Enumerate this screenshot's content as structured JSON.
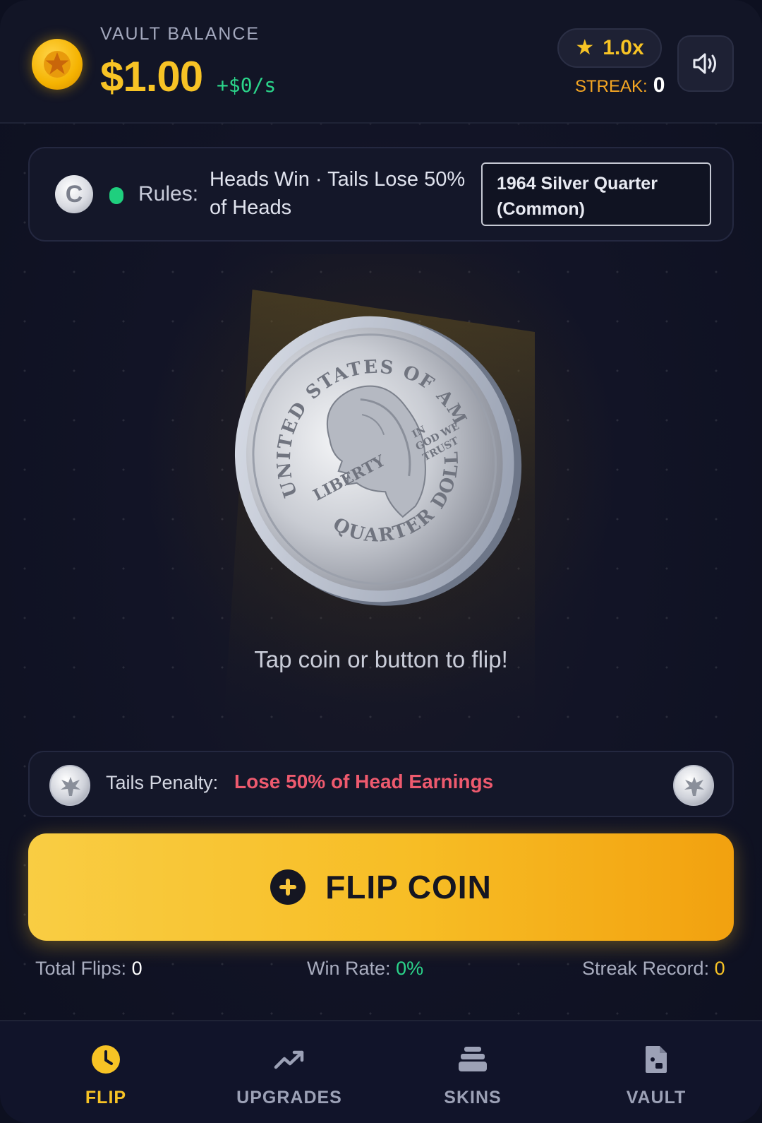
{
  "header": {
    "vault_label": "VAULT BALANCE",
    "balance": "$1.00",
    "rate": "+$0/s",
    "multiplier": "1.0x",
    "streak_label": "STREAK:",
    "streak_value": "0"
  },
  "rules": {
    "label": "Rules:",
    "text": "Heads Win · Tails Lose 50% of Heads",
    "coin_type": "1964 Silver Quarter (Common)"
  },
  "stage": {
    "tap_hint": "Tap coin or button to flip!"
  },
  "penalty": {
    "label": "Tails Penalty:",
    "value": "Lose 50% of Head Earnings"
  },
  "flip_button": {
    "label": "FLIP COIN"
  },
  "stats": {
    "total_flips_label": "Total Flips:",
    "total_flips": "0",
    "win_rate_label": "Win Rate:",
    "win_rate": "0%",
    "streak_record_label": "Streak Record:",
    "streak_record": "0"
  },
  "nav": {
    "items": [
      {
        "label": "FLIP",
        "icon": "clock-icon",
        "active": true
      },
      {
        "label": "UPGRADES",
        "icon": "trending-up-icon",
        "active": false
      },
      {
        "label": "SKINS",
        "icon": "layers-icon",
        "active": false
      },
      {
        "label": "VAULT",
        "icon": "document-icon",
        "active": false
      }
    ]
  },
  "colors": {
    "accent_gold": "#f7c325",
    "positive_green": "#2bd48a",
    "penalty_red": "#ee5a6e",
    "background": "#0d1020"
  }
}
